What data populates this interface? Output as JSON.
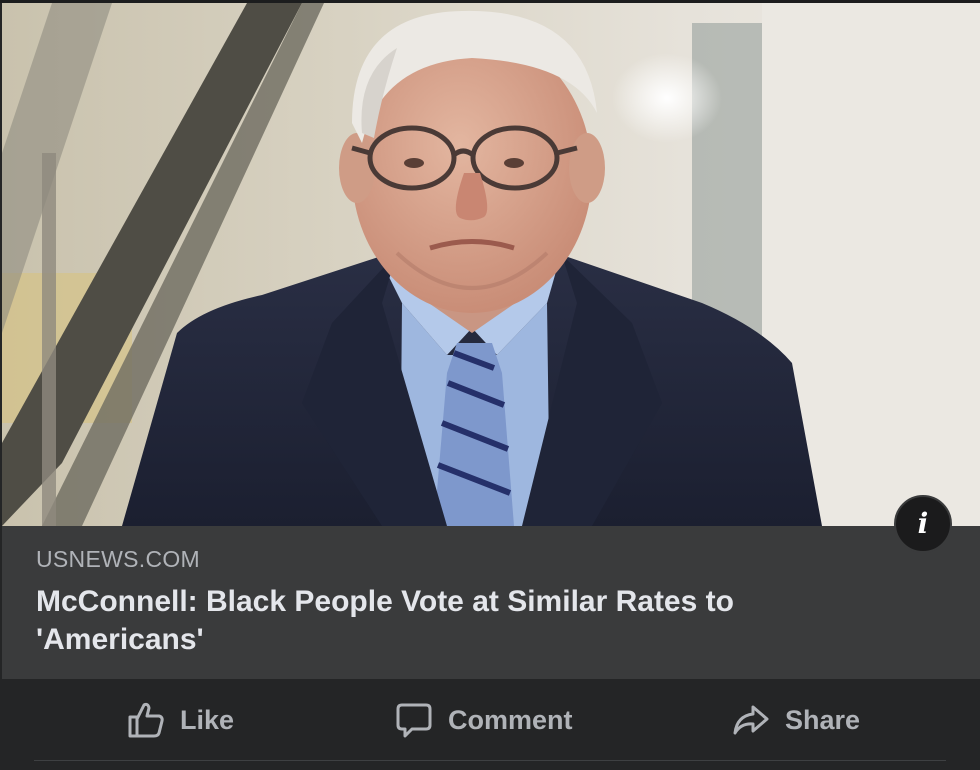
{
  "post": {
    "image": {
      "icon": "news-photo"
    },
    "info_button": {
      "icon": "info-icon",
      "glyph": "i"
    },
    "link": {
      "domain": "USNEWS.COM",
      "headline": "McConnell: Black People Vote at Similar Rates to 'Americans'"
    },
    "actions": {
      "like": {
        "label": "Like",
        "icon": "thumbs-up-icon"
      },
      "comment": {
        "label": "Comment",
        "icon": "comment-bubble-icon"
      },
      "share": {
        "label": "Share",
        "icon": "share-arrow-icon"
      }
    }
  },
  "colors": {
    "background": "#242526",
    "link_preview_background": "#3a3b3c",
    "headline_text": "#e4e6eb",
    "secondary_text": "#b0b3b8"
  }
}
